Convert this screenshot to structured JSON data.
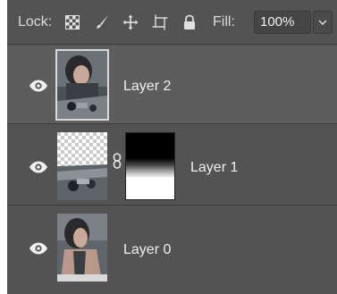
{
  "toolbar": {
    "lock_label": "Lock:",
    "fill_label": "Fill:",
    "fill_value": "100%",
    "lock_icons": [
      "lock-transparent-pixels-icon",
      "lock-image-pixels-icon",
      "lock-position-icon",
      "lock-artboard-icon",
      "lock-all-icon"
    ]
  },
  "layers": [
    {
      "name": "Layer 2",
      "selected": true,
      "has_mask": false
    },
    {
      "name": "Layer 1",
      "selected": false,
      "has_mask": true
    },
    {
      "name": "Layer 0",
      "selected": false,
      "has_mask": false
    }
  ],
  "colors": {
    "panel_bg": "#535353",
    "selected_row_bg": "#5d5d5d",
    "divider": "#3c3c3c",
    "text": "#efefef"
  }
}
